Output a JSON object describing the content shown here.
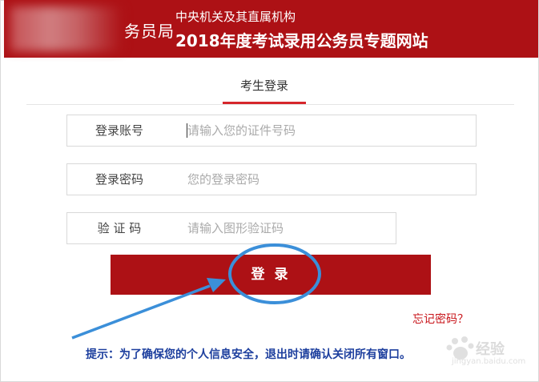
{
  "header": {
    "logo_text": "务员局",
    "org": "中央机关及其直属机构",
    "title": "2018年度考试录用公务员专题网站"
  },
  "tab": {
    "label": "考生登录"
  },
  "form": {
    "account": {
      "label": "登录账号",
      "placeholder": "请输入您的证件号码"
    },
    "password": {
      "label": "登录密码",
      "placeholder": "您的登录密码"
    },
    "captcha": {
      "label": "验 证 码",
      "placeholder": "请输入图形验证码"
    }
  },
  "login_button": "登 录",
  "forgot_link": "忘记密码？",
  "tip": "提示：为了确保您的个人信息安全，退出时请确认关闭所有窗口。",
  "watermark": {
    "text": "经验",
    "sub": "jingyan.baidu.com"
  },
  "colors": {
    "brand_red": "#ad1115",
    "link_red": "#c8141a",
    "tip_blue": "#1d3f9e",
    "annotation_blue": "#3b8fd9"
  }
}
